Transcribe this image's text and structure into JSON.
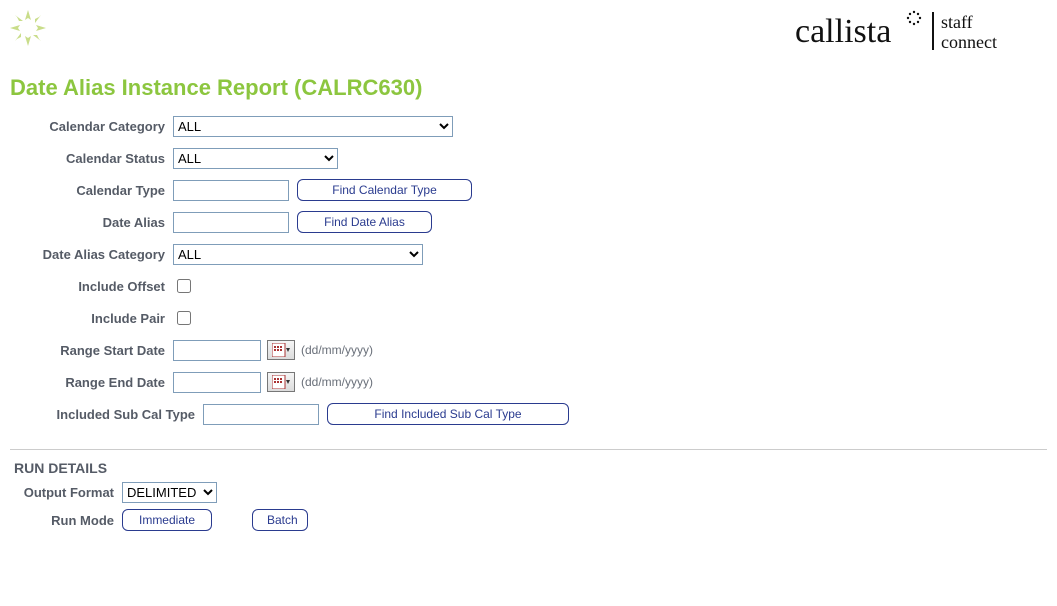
{
  "brand": {
    "name": "callista",
    "tag1": "staff",
    "tag2": "connect"
  },
  "page_title": "Date Alias Instance Report (CALRC630)",
  "labels": {
    "cal_cat": "Calendar Category",
    "cal_status": "Calendar Status",
    "cal_type": "Calendar Type",
    "date_alias": "Date Alias",
    "da_cat": "Date Alias Category",
    "inc_offset": "Include Offset",
    "inc_pair": "Include Pair",
    "range_start": "Range Start Date",
    "range_end": "Range End Date",
    "inc_sub": "Included Sub Cal Type"
  },
  "values": {
    "cal_cat": "ALL",
    "cal_status": "ALL",
    "cal_type": "",
    "date_alias": "",
    "da_cat": "ALL",
    "inc_offset": false,
    "inc_pair": false,
    "range_start": "",
    "range_end": "",
    "inc_sub": ""
  },
  "hints": {
    "date_fmt": "(dd/mm/yyyy)"
  },
  "buttons": {
    "find_cal_type": "Find Calendar Type",
    "find_date_alias": "Find Date Alias",
    "find_inc_sub": "Find Included Sub Cal Type",
    "immediate": "Immediate",
    "batch": "Batch"
  },
  "run": {
    "section": "RUN DETAILS",
    "output_fmt_lbl": "Output Format",
    "output_fmt_val": "DELIMITED",
    "run_mode_lbl": "Run Mode"
  }
}
